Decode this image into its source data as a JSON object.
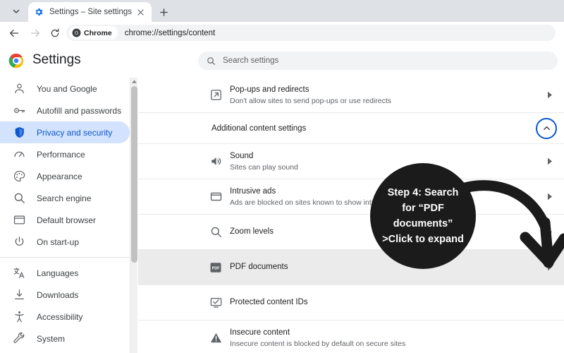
{
  "browser": {
    "tab_search_icon": "chevron-down-icon",
    "tab": {
      "favicon": "settings-gear-icon",
      "title": "Settings – Site settings",
      "close_icon": "close-icon"
    },
    "new_tab_label": "+",
    "nav": {
      "back_icon": "arrow-left-icon",
      "forward_icon": "arrow-right-icon",
      "reload_icon": "reload-icon"
    },
    "omnibox": {
      "chip_icon": "chrome-logo-icon",
      "chip_label": "Chrome",
      "url": "chrome://settings/content"
    }
  },
  "header": {
    "logo_icon": "chrome-logo-icon",
    "title": "Settings",
    "search": {
      "icon": "search-icon",
      "placeholder": "Search settings"
    }
  },
  "sidebar": {
    "groups": [
      {
        "items": [
          {
            "icon": "person-icon",
            "label": "You and Google",
            "active": false
          },
          {
            "icon": "key-icon",
            "label": "Autofill and passwords",
            "active": false
          },
          {
            "icon": "shield-icon",
            "label": "Privacy and security",
            "active": true
          },
          {
            "icon": "speed-icon",
            "label": "Performance",
            "active": false
          },
          {
            "icon": "palette-icon",
            "label": "Appearance",
            "active": false
          },
          {
            "icon": "search-icon",
            "label": "Search engine",
            "active": false
          },
          {
            "icon": "browser-icon",
            "label": "Default browser",
            "active": false
          },
          {
            "icon": "power-icon",
            "label": "On start-up",
            "active": false
          }
        ]
      },
      {
        "items": [
          {
            "icon": "translate-icon",
            "label": "Languages",
            "active": false
          },
          {
            "icon": "download-icon",
            "label": "Downloads",
            "active": false
          },
          {
            "icon": "accessibility-icon",
            "label": "Accessibility",
            "active": false
          },
          {
            "icon": "wrench-icon",
            "label": "System",
            "active": false
          }
        ]
      }
    ],
    "scrollbar": {
      "up_icon": "caret-up-icon"
    }
  },
  "content": {
    "rows_before": [
      {
        "icon": "external-link-icon",
        "title": "Pop-ups and redirects",
        "sub": "Don't allow sites to send pop-ups or use redirects",
        "arrow": "caret-right-icon",
        "highlighted": false
      }
    ],
    "section": {
      "title": "Additional content settings",
      "collapse_icon": "chevron-up-icon",
      "expanded": true
    },
    "rows_after": [
      {
        "icon": "sound-icon",
        "title": "Sound",
        "sub": "Sites can play sound",
        "arrow": "caret-right-icon",
        "highlighted": false
      },
      {
        "icon": "ads-icon",
        "title": "Intrusive ads",
        "sub": "Ads are blocked on sites known to show intrusive ads",
        "arrow": "caret-right-icon",
        "highlighted": false
      },
      {
        "icon": "search-icon",
        "title": "Zoom levels",
        "sub": "",
        "arrow": "caret-right-icon",
        "highlighted": false
      },
      {
        "icon": "pdf-icon",
        "title": "PDF documents",
        "sub": "",
        "arrow": "caret-right-icon",
        "highlighted": true
      },
      {
        "icon": "protected-content-icon",
        "title": "Protected content IDs",
        "sub": "",
        "arrow": "",
        "highlighted": false
      },
      {
        "icon": "warning-icon",
        "title": "Insecure content",
        "sub": "Insecure content is blocked by default on secure sites",
        "arrow": "",
        "highlighted": false
      }
    ]
  },
  "annotation": {
    "lines": [
      "Step 4: Search",
      "for “PDF",
      "documents”",
      ">Click to expand"
    ],
    "text": "Step 4: Search for “PDF documents” >Click to expand",
    "shape": "filled-circle-callout",
    "arrow": "curved-down-arrow",
    "color": "#1b1b1b",
    "text_color": "#ffffff"
  },
  "colors": {
    "accent": "#0b57d0",
    "active_bg": "#d3e3fd",
    "tabstrip": "#dee1e6",
    "field_bg": "#f1f3f4",
    "highlight_row": "#ebebeb"
  }
}
